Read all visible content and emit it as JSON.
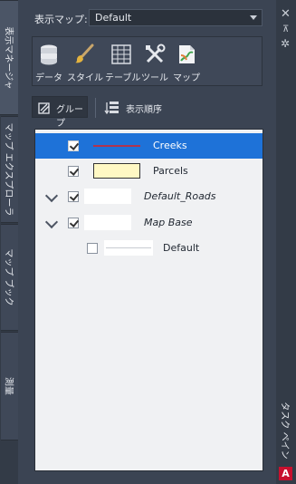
{
  "tabs": [
    {
      "label": "表示マネージャ",
      "active": true
    },
    {
      "label": "マップ エクスプローラ",
      "active": false
    },
    {
      "label": "マップ ブック",
      "active": false
    },
    {
      "label": "測量",
      "active": false
    }
  ],
  "map_select": {
    "label": "表示マップ:",
    "value": "Default"
  },
  "toolbar": [
    {
      "label": "データ",
      "icon": "database-icon"
    },
    {
      "label": "スタイル",
      "icon": "brush-icon"
    },
    {
      "label": "テーブル",
      "icon": "table-icon"
    },
    {
      "label": "ツール",
      "icon": "tools-icon"
    },
    {
      "label": "マップ",
      "icon": "map-icon"
    }
  ],
  "group_button": "グループ",
  "order_button": "表示順序",
  "layers": [
    {
      "name": "Creeks",
      "checked": true,
      "selected": true,
      "expandable": false,
      "italic": false,
      "swatch": "line-red"
    },
    {
      "name": "Parcels",
      "checked": true,
      "selected": false,
      "expandable": false,
      "italic": false,
      "swatch": "fill-yellow"
    },
    {
      "name": "Default_Roads",
      "checked": true,
      "selected": false,
      "expandable": true,
      "italic": true,
      "swatch": "none"
    },
    {
      "name": "Map Base",
      "checked": true,
      "selected": false,
      "expandable": true,
      "italic": true,
      "swatch": "none"
    },
    {
      "name": "Default",
      "checked": false,
      "selected": false,
      "expandable": false,
      "italic": false,
      "swatch": "line-light"
    }
  ],
  "task_pane_title": "タスク ペイン",
  "right_icons": {
    "close": "✕",
    "pin": "⊼",
    "settings": "✲"
  },
  "app_logo": "A",
  "colors": {
    "selection": "#1e72d8",
    "creek_line": "#e02020",
    "parcel_fill": "#fff8c4"
  }
}
